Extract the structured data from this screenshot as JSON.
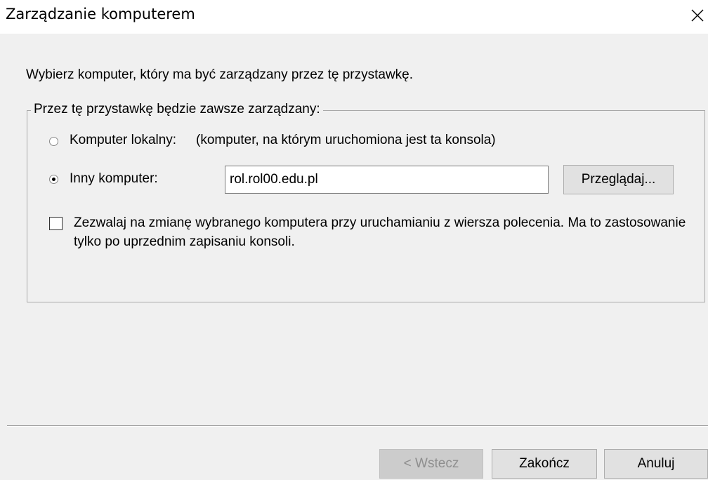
{
  "window": {
    "title": "Zarządzanie komputerem",
    "close_glyph": "✕"
  },
  "page": {
    "instruction": "Wybierz komputer, który ma być zarządzany przez tę przystawkę."
  },
  "group": {
    "legend": "Przez tę przystawkę będzie zawsze zarządzany:",
    "local_label": "Komputer lokalny:",
    "local_desc": "(komputer, na którym uruchomiona jest ta konsola)",
    "local_selected": false,
    "other_label": "Inny komputer:",
    "other_selected": true,
    "computer_name": "rol.rol00.edu.pl",
    "browse_label": "Przeglądaj...",
    "allow_change_checked": false,
    "allow_change_label": "Zezwalaj na zmianę wybranego komputera przy uruchamianiu z wiersza polecenia. Ma to zastosowanie tylko po uprzednim zapisaniu konsoli."
  },
  "buttons": {
    "back": "< Wstecz",
    "back_enabled": false,
    "finish": "Zakończ",
    "cancel": "Anuluj"
  },
  "icons": {
    "close": "close-icon"
  },
  "colors": {
    "dialog_background": "#f0f0f0",
    "title_background": "#ffffff",
    "button_face": "#e1e1e1",
    "disabled_text": "#8e8e8e"
  }
}
